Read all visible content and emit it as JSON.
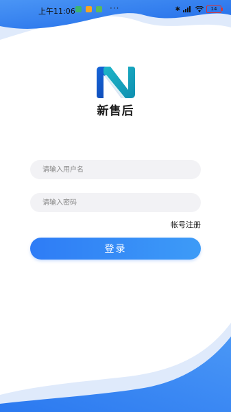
{
  "status_bar": {
    "time": "上午11:06",
    "more": "···",
    "battery_level": "14"
  },
  "app": {
    "name": "新售后",
    "logo_icon": "app-logo-n-icon"
  },
  "form": {
    "username_placeholder": "请输入用户名",
    "password_placeholder": "请输入密码",
    "register_label": "帐号注册",
    "login_label": "登录"
  },
  "colors": {
    "accent": "#2e7cf6",
    "wave_blue": "#2f7ff0"
  }
}
